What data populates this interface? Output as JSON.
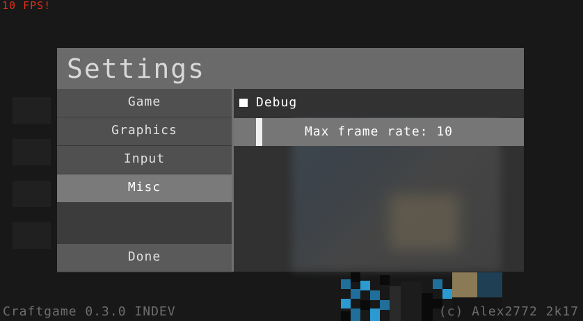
{
  "hud": {
    "fps": "10 FPS!"
  },
  "settings": {
    "title": "Settings",
    "tabs": [
      {
        "label": "Game"
      },
      {
        "label": "Graphics"
      },
      {
        "label": "Input"
      },
      {
        "label": "Misc"
      }
    ],
    "active_tab": "Misc",
    "done_label": "Done",
    "options": {
      "debug_label": "Debug",
      "debug_checked": false,
      "frame_rate_label": "Max frame rate: 10"
    }
  },
  "footer": {
    "version": "Craftgame 0.3.0 INDEV",
    "copyright": "(c) Alex2772 2k17"
  }
}
